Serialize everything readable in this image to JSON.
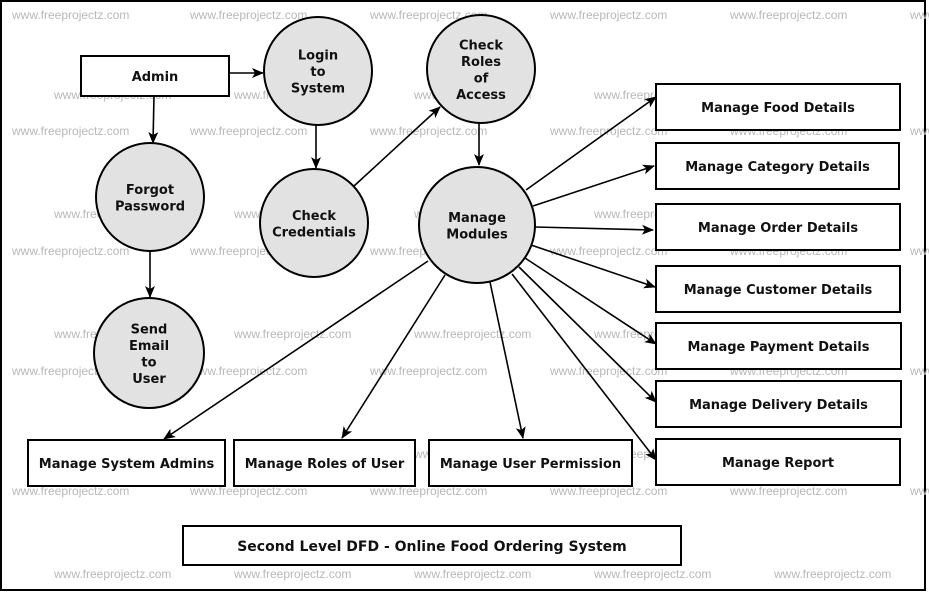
{
  "diagram": {
    "title": "Second Level DFD - Online Food Ordering System",
    "watermark": "www.freeprojectz.com",
    "colors": {
      "process_fill": "#e2e2e2",
      "stroke": "#000000",
      "entity_fill": "#ffffff",
      "watermark": "#b8b8b8"
    },
    "entities": [
      {
        "id": "admin",
        "label": "Admin"
      },
      {
        "id": "food",
        "label": "Manage Food Details"
      },
      {
        "id": "category",
        "label": "Manage Category Details"
      },
      {
        "id": "order",
        "label": "Manage Order Details"
      },
      {
        "id": "customer",
        "label": "Manage Customer Details"
      },
      {
        "id": "payment",
        "label": "Manage Payment Details"
      },
      {
        "id": "delivery",
        "label": "Manage Delivery Details"
      },
      {
        "id": "report",
        "label": "Manage Report"
      },
      {
        "id": "sysadmins",
        "label": "Manage System Admins"
      },
      {
        "id": "roles",
        "label": "Manage Roles of User"
      },
      {
        "id": "permission",
        "label": "Manage User Permission"
      }
    ],
    "processes": [
      {
        "id": "login",
        "lines": [
          "Login",
          "to",
          "System"
        ]
      },
      {
        "id": "checkroles",
        "lines": [
          "Check",
          "Roles",
          "of",
          "Access"
        ]
      },
      {
        "id": "forgot",
        "lines": [
          "Forgot",
          "Password"
        ]
      },
      {
        "id": "checkcred",
        "lines": [
          "Check",
          "Credentials"
        ]
      },
      {
        "id": "modules",
        "lines": [
          "Manage",
          "Modules"
        ]
      },
      {
        "id": "sendemail",
        "lines": [
          "Send",
          "Email",
          "to",
          "User"
        ]
      }
    ],
    "flows": [
      {
        "from": "admin",
        "to": "login"
      },
      {
        "from": "admin",
        "to": "forgot"
      },
      {
        "from": "login",
        "to": "checkcred"
      },
      {
        "from": "checkcred",
        "to": "checkroles"
      },
      {
        "from": "checkroles",
        "to": "modules"
      },
      {
        "from": "forgot",
        "to": "sendemail"
      },
      {
        "from": "modules",
        "to": "food"
      },
      {
        "from": "modules",
        "to": "category"
      },
      {
        "from": "modules",
        "to": "order"
      },
      {
        "from": "modules",
        "to": "customer"
      },
      {
        "from": "modules",
        "to": "payment"
      },
      {
        "from": "modules",
        "to": "delivery"
      },
      {
        "from": "modules",
        "to": "report"
      },
      {
        "from": "modules",
        "to": "sysadmins"
      },
      {
        "from": "modules",
        "to": "roles"
      },
      {
        "from": "modules",
        "to": "permission"
      }
    ]
  }
}
